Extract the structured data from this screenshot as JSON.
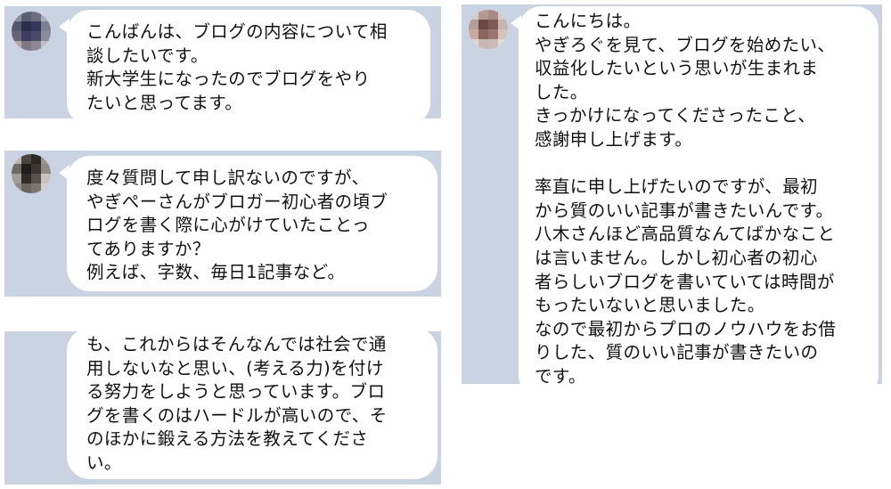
{
  "messages": [
    {
      "lines": [
        "こんばんは、ブログの内容について相",
        "談したいです。",
        "新大学生になったのでブログをやり",
        "たいと思ってます。"
      ]
    },
    {
      "lines": [
        "度々質問して申し訳ないのですが、",
        "やぎぺーさんがブロガー初心者の頃ブ",
        "ログを書く際に心がけていたことっ",
        "てありますか？",
        "例えば、字数、毎日1記事など。"
      ]
    },
    {
      "lines": [
        "も、これからはそんなんでは社会で通",
        "用しないなと思い、(考える力)を付け",
        "る努力をしようと思っています。ブロ",
        "グを書くのはハードルが高いので、そ",
        "のほかに鍛える方法を教えてくださ",
        "い。"
      ]
    },
    {
      "lines": [
        "こんにちは。",
        "やぎろぐを見て、ブログを始めたい、",
        "収益化したいという思いが生まれま",
        "した。",
        "きっかけになってくださったこと、",
        "感謝申し上げます。",
        "",
        "率直に申し上げたいのですが、最初",
        "から質のいい記事が書きたいんです。",
        "八木さんほど高品質なんてばかなこと",
        "は言いません。しかし初心者の初心",
        "者らしいブログを書いていては時間が",
        "もったいないと思いました。",
        "なので最初からプロのノウハウをお借",
        "りした、質のいい記事が書きたいの",
        "です。"
      ]
    }
  ],
  "colors": {
    "panel_bg": "#c9d3e1",
    "bubble_bg": "#ffffff",
    "text": "#111111"
  }
}
